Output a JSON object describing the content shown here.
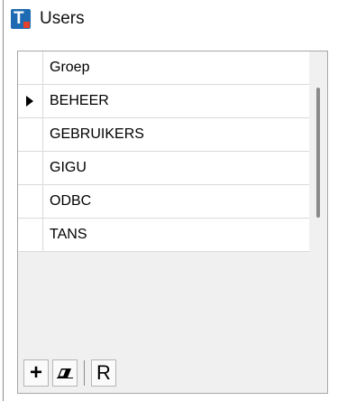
{
  "window": {
    "title": "Users",
    "logo_letter": "T"
  },
  "grid": {
    "column_header": "Groep",
    "rows": [
      "BEHEER",
      "GEBRUIKERS",
      "GIGU",
      "ODBC",
      "TANS"
    ],
    "selected_row": 0
  },
  "toolbar": {
    "add_label": "+",
    "refresh_label": "R"
  },
  "icons": {
    "add": "plus-icon",
    "delete": "eraser-icon",
    "refresh": "refresh-R"
  },
  "colors": {
    "logo_bg": "#1f6bb3",
    "logo_accent": "#e2412c"
  }
}
